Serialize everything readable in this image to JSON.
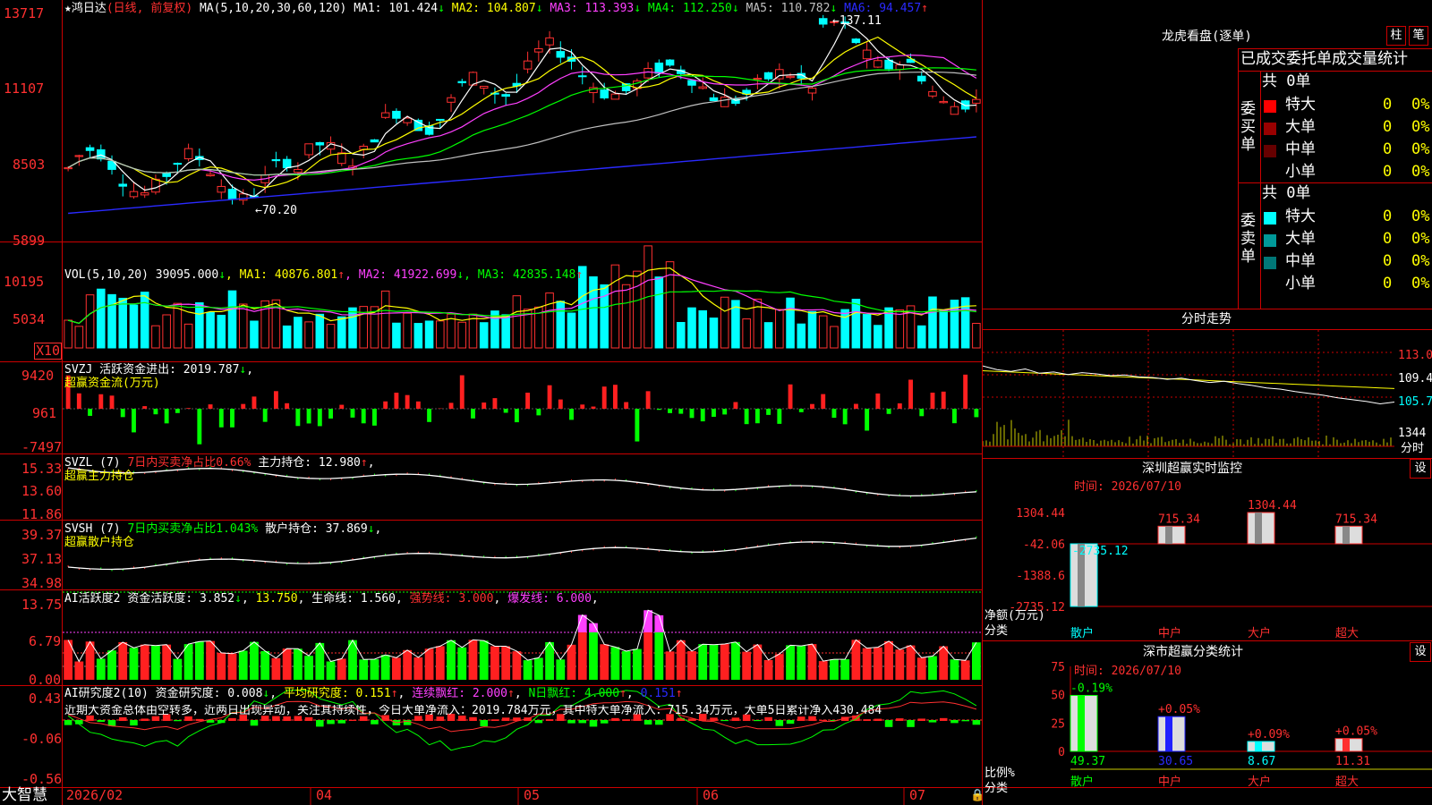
{
  "app_brand": "大智慧",
  "main": {
    "title_star": "★",
    "stock": "鸿日达",
    "mode": "(日线, 前复权)",
    "ma_label": "MA(5,10,20,30,60,120)",
    "ma": [
      {
        "label": "MA1: 101.424",
        "arrow": "↓",
        "color": "#ffffff"
      },
      {
        "label": "MA2: 104.807",
        "arrow": "↓",
        "color": "#ffff00"
      },
      {
        "label": "MA3: 113.393",
        "arrow": "↓",
        "color": "#ff40ff"
      },
      {
        "label": "MA4: 112.250",
        "arrow": "↓",
        "color": "#00ff00"
      },
      {
        "label": "MA5: 110.782",
        "arrow": "↓",
        "color": "#c0c0c0"
      },
      {
        "label": "MA6: 94.457",
        "arrow": "↑",
        "color": "#2a2aff"
      }
    ],
    "high_mark": "137.11",
    "low_mark": "70.20",
    "y_ticks": [
      "13717",
      "11107",
      "8503",
      "5899"
    ]
  },
  "vol": {
    "label": "VOL(5,10,20)",
    "value": "39095.000",
    "value_arrow": "↓",
    "ma": [
      {
        "label": "MA1: 40876.801",
        "arrow": "↑",
        "color": "#ffff00"
      },
      {
        "label": "MA2: 41922.699",
        "arrow": "↓",
        "color": "#ff40ff"
      },
      {
        "label": "MA3: 42835.148",
        "arrow": "↑",
        "color": "#00ff00"
      }
    ],
    "y_ticks": [
      "10195",
      "5034"
    ],
    "unit": "X10"
  },
  "svzj": {
    "label": "SVZJ  活跃资金进出: 2019.787",
    "arrow": "↓",
    "sub": "超赢资金流(万元)",
    "y_ticks": [
      "9420",
      "961",
      "-7497"
    ]
  },
  "svzl": {
    "label": "SVZL (7)",
    "ratio": "7日内买卖净占比0.66%",
    "hold": "主力持仓: 12.980",
    "arrow": "↑",
    "sub": "超赢主力持仓",
    "y_ticks": [
      "15.33",
      "13.60",
      "11.86"
    ]
  },
  "svsh": {
    "label": "SVSH (7)",
    "ratio": "7日内买卖净占比1.043%",
    "hold": "散户持仓: 37.869",
    "arrow": "↓",
    "sub": "超赢散户持仓",
    "y_ticks": [
      "39.37",
      "37.13",
      "34.98"
    ]
  },
  "ai1": {
    "label": "AI活跃度2",
    "a": "资金活跃度: 3.852",
    "b": "13.750",
    "c": "生命线: 1.560",
    "d": "强势线: 3.000",
    "e": "爆发线: 6.000",
    "y_ticks": [
      "13.75",
      "6.79",
      "0.00"
    ]
  },
  "ai2": {
    "label": "AI研究度2(10)",
    "a": "资金研究度: 0.008",
    "b": "平均研究度: 0.151",
    "c": "连续飘红: 2.000",
    "d": "N日飘红: 4.000",
    "e": "0.151",
    "comment": "近期大资金总体由空转多，近两日出现异动，关注其持续性，今日大单净流入：2019.784万元，其中特大单净流入：715.34万元，大单5日累计净入430.484",
    "y_ticks": [
      "0.43",
      "-0.06",
      "-0.56"
    ]
  },
  "x_axis": [
    "2026/02",
    "04",
    "05",
    "06",
    "07"
  ],
  "right": {
    "lhb_title": "龙虎看盘(逐单)",
    "btn1": "柱",
    "btn2": "笔",
    "stats_title": "已成交委托单成交量统计",
    "buy_side": "委买单",
    "sell_side": "委卖单",
    "buy_total": "共 0单",
    "sell_total": "共 0单",
    "buy_rows": [
      {
        "name": "特大",
        "count": "0",
        "pct": "0%",
        "color": "#ff0000"
      },
      {
        "name": "大单",
        "count": "0",
        "pct": "0%",
        "color": "#990000"
      },
      {
        "name": "中单",
        "count": "0",
        "pct": "0%",
        "color": "#660000"
      },
      {
        "name": "小单",
        "count": "0",
        "pct": "0%",
        "color": "#000000"
      }
    ],
    "sell_rows": [
      {
        "name": "特大",
        "count": "0",
        "pct": "0%",
        "color": "#00ffff"
      },
      {
        "name": "大单",
        "count": "0",
        "pct": "0%",
        "color": "#009999"
      },
      {
        "name": "中单",
        "count": "0",
        "pct": "0%",
        "color": "#007777"
      },
      {
        "name": "小单",
        "count": "0",
        "pct": "0%",
        "color": "#000000"
      }
    ],
    "fs_title": "分时走势",
    "fs_ticks": [
      "113.0",
      "109.4",
      "105.7",
      "1344"
    ],
    "fs_xlabel": "分时",
    "mon_title": "深圳超赢实时监控",
    "mon_set": "设",
    "mon_time": "时间: 2026/07/10",
    "mon_ticks": [
      "1304.44",
      "-42.06",
      "-1388.6",
      "-2735.12"
    ],
    "mon_unit1": "净额(万元)",
    "mon_unit2": "分类",
    "cls_title": "深市超赢分类统计",
    "cls_set": "设",
    "cls_time": "时间: 2026/07/10",
    "cls_ticks": [
      "75",
      "50",
      "25",
      "0"
    ],
    "cls_unit1": "比例%",
    "cls_unit2": "分类"
  },
  "chart_data": [
    {
      "type": "bar",
      "title": "深圳超赢实时监控",
      "ylabel": "净额(万元)",
      "xlabel": "分类",
      "categories": [
        "散户",
        "中户",
        "大户",
        "超大"
      ],
      "values": [
        -2735.12,
        715.34,
        1304.44,
        715.34
      ],
      "ylim": [
        -2735.12,
        1304.44
      ]
    },
    {
      "type": "bar",
      "title": "深市超赢分类统计",
      "ylabel": "比例%",
      "xlabel": "分类",
      "categories": [
        "散户",
        "中户",
        "大户",
        "超大"
      ],
      "values": [
        49.37,
        30.65,
        8.67,
        11.31
      ],
      "change_labels": [
        "-0.19%",
        "+0.05%",
        "+0.09%",
        "+0.05%"
      ],
      "ylim": [
        0,
        75
      ]
    },
    {
      "type": "line",
      "title": "分时走势",
      "y_ticks": [
        113.0,
        109.4,
        105.7
      ],
      "values": [
        110.8,
        110.2,
        109.9,
        110.3,
        109.6,
        109.8,
        109.4,
        109.7,
        109.5,
        109.2,
        109.3,
        109.0,
        108.9,
        108.6,
        108.8,
        108.4,
        108.1,
        108.3,
        107.9,
        107.6,
        107.2,
        107.0,
        106.6,
        106.3,
        106.0,
        105.6,
        105.3,
        105.0,
        104.6,
        104.9
      ],
      "avg_values": [
        110.0,
        109.9,
        109.8,
        109.7,
        109.6,
        109.5,
        109.4,
        109.3,
        109.2,
        109.1,
        109.0,
        108.9,
        108.8,
        108.7,
        108.6,
        108.5,
        108.4,
        108.3,
        108.2,
        108.1,
        108.0,
        107.9,
        107.8,
        107.7,
        107.6,
        107.5,
        107.4,
        107.3,
        107.2,
        107.1
      ]
    }
  ]
}
